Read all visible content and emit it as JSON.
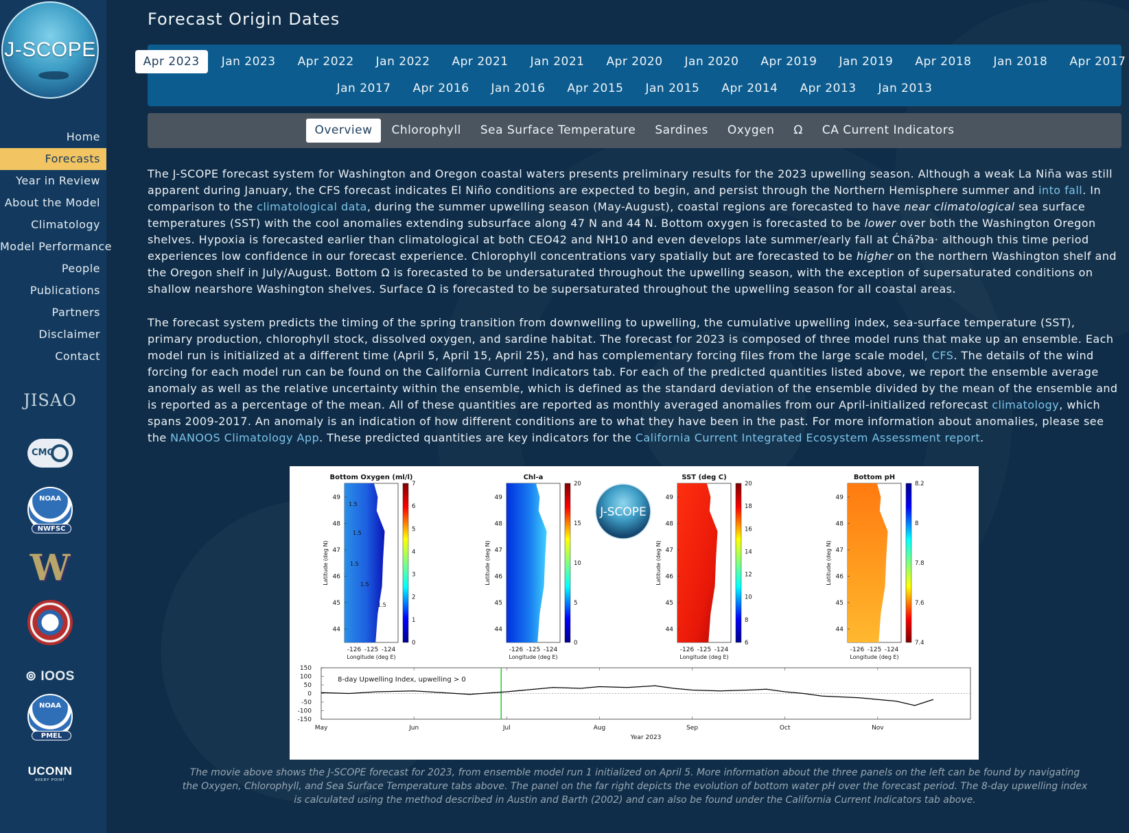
{
  "sidebar": {
    "logo_text": "J-SCOPE",
    "nav": [
      {
        "label": "Home",
        "active": false
      },
      {
        "label": "Forecasts",
        "active": true
      },
      {
        "label": "Year in Review",
        "active": false
      },
      {
        "label": "About the Model",
        "active": false
      },
      {
        "label": "Climatology",
        "active": false
      },
      {
        "label": "Model Performance",
        "active": false
      },
      {
        "label": "People",
        "active": false
      },
      {
        "label": "Publications",
        "active": false
      },
      {
        "label": "Partners",
        "active": false
      },
      {
        "label": "Disclaimer",
        "active": false
      },
      {
        "label": "Contact",
        "active": false
      }
    ],
    "partners": {
      "jisao": "JISAO",
      "cmg": "CMG",
      "noaa1_top": "NOAA",
      "noaa1_sub": "NWFSC",
      "uw": "W",
      "nanoos": "NANOOS",
      "ioos": "IOOS",
      "noaa2_top": "NOAA",
      "noaa2_sub": "PMEL",
      "uconn": "UCONN",
      "uconn_sub": "AVERY POINT"
    }
  },
  "main": {
    "title": "Forecast Origin Dates",
    "dates_row1": [
      "Apr 2023",
      "Jan 2023",
      "Apr 2022",
      "Jan 2022",
      "Apr 2021",
      "Jan 2021",
      "Apr 2020",
      "Jan 2020",
      "Apr 2019",
      "Jan 2019",
      "Apr 2018",
      "Jan 2018",
      "Apr 2017"
    ],
    "dates_row2": [
      "Jan 2017",
      "Apr 2016",
      "Jan 2016",
      "Apr 2015",
      "Jan 2015",
      "Apr 2014",
      "Apr 2013",
      "Jan 2013"
    ],
    "active_date": "Apr 2023",
    "topics": [
      "Overview",
      "Chlorophyll",
      "Sea Surface Temperature",
      "Sardines",
      "Oxygen",
      "Ω",
      "CA Current Indicators"
    ],
    "active_topic": "Overview",
    "para1": {
      "t1": "The J-SCOPE forecast system for Washington and Oregon coastal waters presents preliminary results for the 2023 upwelling season. Although a weak La Niña was still apparent during January, the CFS forecast indicates El Niño conditions are expected to begin, and persist through the Northern Hemisphere summer and ",
      "l1": "into fall",
      "t2": ". In comparison to the ",
      "l2": "climatological data",
      "t3": ", during the summer upwelling season (May-August), coastal regions are forecasted to have ",
      "e1": "near climatological",
      "t4": " sea surface temperatures (SST) with the cool anomalies extending subsurface along 47 N and 44 N. Bottom oxygen is forecasted to be ",
      "e2": "lower",
      "t5": " over both the Washington Oregon shelves. Hypoxia is forecasted earlier than climatological at both CEO42 and NH10 and even develops late summer/early fall at Ćháʔba· although this time period experiences low confidence in our forecast experience. Chlorophyll concentrations vary spatially but are forecasted to be ",
      "e3": "higher",
      "t6": " on the northern Washington shelf and the Oregon shelf in July/August. Bottom Ω is forecasted to be undersaturated throughout the upwelling season, with the exception of supersaturated conditions on shallow nearshore Washington shelves. Surface Ω is forecasted to be supersaturated throughout the upwelling season for all coastal areas."
    },
    "para2": {
      "t1": "The forecast system predicts the timing of the spring transition from downwelling to upwelling, the cumulative upwelling index, sea-surface temperature (SST), primary production, chlorophyll stock, dissolved oxygen, and sardine habitat. The forecast for 2023 is composed of three model runs that make up an ensemble. Each model run is initialized at a different time (April 5, April 15, April 25), and has complementary forcing files from the large scale model, ",
      "l1": "CFS",
      "t2": ". The details of the wind forcing for each model run can be found on the California Current Indicators tab. For each of the predicted quantities listed above, we report the ensemble average anomaly as well as the relative uncertainty within the ensemble, which is defined as the standard deviation of the ensemble divided by the mean of the ensemble and is reported as a percentage of the mean. All of these quantities are reported as monthly averaged anomalies from our April-initialized reforecast ",
      "l2": "climatology",
      "t3": ", which spans 2009-2017. An anomaly is an indication of how different conditions are to what they have been in the past. For more information about anomalies, please see the ",
      "l3": "NANOOS Climatology App",
      "t4": ". These predicted quantities are key indicators for the ",
      "l4": "California Current Integrated Ecosystem Assessment report",
      "t5": "."
    },
    "figure": {
      "logo_text": "J-SCOPE",
      "ylabel": "Latitude (deg N)",
      "xlabel": "Longitude (deg E)",
      "lat_ticks": [
        "49",
        "48",
        "47",
        "46",
        "45",
        "44"
      ],
      "lon_ticks": [
        "-126",
        "-125",
        "-124"
      ],
      "maps": [
        {
          "title": "Bottom Oxygen (ml/l)",
          "colorbar_ticks": [
            "7",
            "6",
            "5",
            "4",
            "3",
            "2",
            "1",
            "0"
          ],
          "colorscale": "jet"
        },
        {
          "title": "Chl-a",
          "colorbar_ticks": [
            "20",
            "15",
            "10",
            "5",
            "0"
          ],
          "colorscale": "jet"
        },
        {
          "title": "SST (deg C)",
          "colorbar_ticks": [
            "20",
            "18",
            "16",
            "14",
            "12",
            "10",
            "8",
            "6"
          ],
          "colorscale": "jet"
        },
        {
          "title": "Bottom pH",
          "colorbar_ticks": [
            "8.2",
            "8",
            "7.8",
            "7.6",
            "7.4"
          ],
          "colorscale": "jet_reversed"
        }
      ],
      "contour_labels": [
        "1.5",
        "1.5",
        "1.5",
        "1.5",
        "1.5"
      ]
    },
    "caption": "The movie above shows the J-SCOPE forecast for 2023, from ensemble model run 1 initialized on April 5. More information about the three panels on the left can be found by navigating the Oxygen, Chlorophyll, and Sea Surface Temperature tabs above. The panel on the far right depicts the evolution of bottom water pH over the forecast period. The 8-day upwelling index is calculated using the method described in Austin and Barth (2002) and can also be found under the California Current Indicators tab above."
  },
  "chart_data": {
    "type": "line",
    "title": "",
    "annotation": "8-day Upwelling Index, upwelling > 0",
    "xlabel": "Year 2023",
    "ylabel": "",
    "x_tick_labels": [
      "May",
      "Jun",
      "Jul",
      "Aug",
      "Sep",
      "Oct",
      "Nov"
    ],
    "yticks": [
      150,
      100,
      50,
      0,
      -50,
      -100,
      -150
    ],
    "ylim": [
      -150,
      150
    ],
    "grid": false,
    "marker_month": "Jul",
    "marker_color": "#22cc22",
    "series": [
      {
        "x_month": [
          0,
          0.3,
          0.6,
          1.0,
          1.3,
          1.6,
          2.0,
          2.2,
          2.5,
          2.8,
          3.0,
          3.3,
          3.6,
          3.8,
          4.0,
          4.3,
          4.6,
          4.8,
          5.0,
          5.2,
          5.4,
          5.6,
          5.8,
          6.0,
          6.2,
          6.4,
          6.6
        ],
        "values": [
          5,
          0,
          10,
          15,
          5,
          -5,
          10,
          20,
          35,
          30,
          40,
          35,
          45,
          30,
          20,
          15,
          20,
          25,
          10,
          0,
          -15,
          -20,
          -25,
          -35,
          -45,
          -70,
          -35
        ]
      }
    ]
  }
}
